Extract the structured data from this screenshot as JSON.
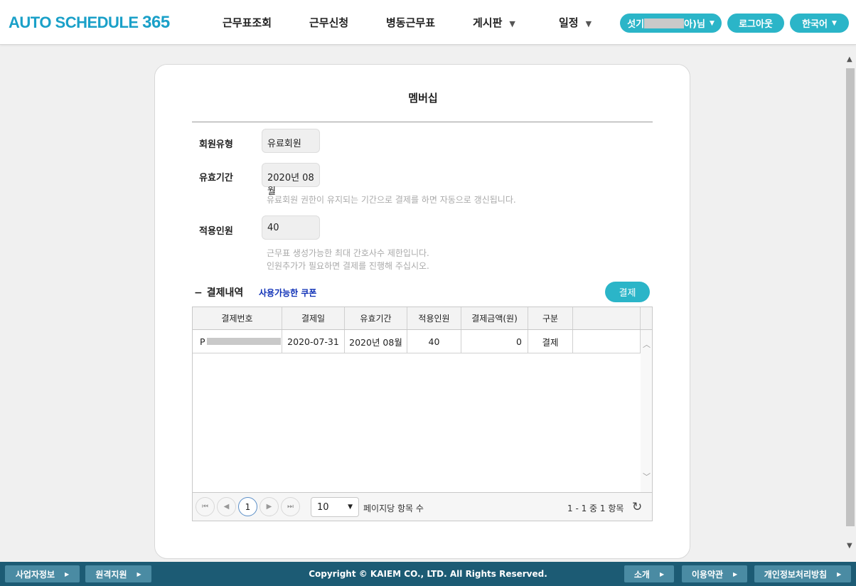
{
  "header": {
    "logo_text": "AUTO SCHEDULE ",
    "logo_num": "365",
    "nav": [
      {
        "label": "근무표조회"
      },
      {
        "label": "근무신청"
      },
      {
        "label": "병동근무표"
      },
      {
        "label": "게시판"
      },
      {
        "label": "일정"
      }
    ],
    "user_prefix": "섯기",
    "user_suffix": "아)님",
    "logout_label": "로그아웃",
    "language_label": "한국어"
  },
  "card": {
    "title": "멤버십",
    "member_type_label": "회원유형",
    "member_type_value": "유료회원",
    "valid_period_label": "유효기간",
    "valid_period_value": "2020년 08월",
    "valid_period_hint": "유료회원 권한이 유지되는 기간으로 결제를 하면 자동으로 갱신됩니다.",
    "apply_count_label": "적용인원",
    "apply_count_value": "40",
    "apply_hint_1": "근무표 생성가능한 최대 간호사수 제한입니다.",
    "apply_hint_2": "인원추가가 필요하면 결제를 진행해 주십시오."
  },
  "payment": {
    "toggle": "−",
    "section_title": "결제내역",
    "coupon_link": "사용가능한 쿠폰",
    "pay_button": "결제",
    "columns": [
      "결제번호",
      "결제일",
      "유효기간",
      "적용인원",
      "결제금액(원)",
      "구분"
    ],
    "rows": [
      {
        "id_prefix": "P",
        "date": "2020-07-31",
        "period": "2020년 08월",
        "count": "40",
        "amount": "0",
        "type": "결제"
      }
    ],
    "pager": {
      "current_page": "1",
      "page_size": "10",
      "page_size_label": "페이지당 항목 수",
      "summary": "1 - 1 중 1 항목"
    }
  },
  "footer": {
    "company_info": "사업자정보",
    "remote_support": "원격지원",
    "copyright": "Copyright © KAIEM CO., LTD. All Rights Reserved.",
    "intro": "소개",
    "terms": "이용약관",
    "privacy": "개인정보처리방침"
  }
}
